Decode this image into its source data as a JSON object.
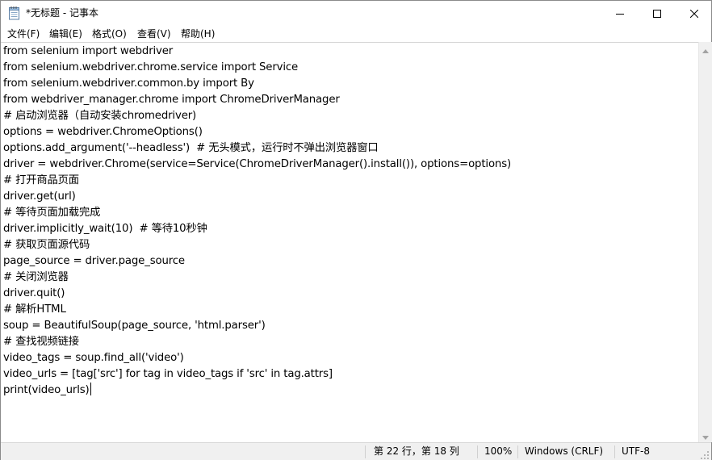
{
  "window": {
    "title": "*无标题 - 记事本",
    "icon": "notepad-icon",
    "controls": {
      "minimize": "minimize-icon",
      "maximize": "maximize-icon",
      "close": "close-icon"
    }
  },
  "menu": {
    "items": [
      {
        "label": "文件(F)"
      },
      {
        "label": "编辑(E)"
      },
      {
        "label": "格式(O)"
      },
      {
        "label": "查看(V)"
      },
      {
        "label": "帮助(H)"
      }
    ]
  },
  "editor": {
    "lines": [
      "from selenium import webdriver",
      "from selenium.webdriver.chrome.service import Service",
      "from selenium.webdriver.common.by import By",
      "from webdriver_manager.chrome import ChromeDriverManager",
      "# 启动浏览器（自动安装chromedriver)",
      "options = webdriver.ChromeOptions()",
      "options.add_argument('--headless')  # 无头模式，运行时不弹出浏览器窗口",
      "driver = webdriver.Chrome(service=Service(ChromeDriverManager().install()), options=options)",
      "# 打开商品页面",
      "driver.get(url)",
      "# 等待页面加载完成",
      "driver.implicitly_wait(10)  # 等待10秒钟",
      "# 获取页面源代码",
      "page_source = driver.page_source",
      "# 关闭浏览器",
      "driver.quit()",
      "# 解析HTML",
      "soup = BeautifulSoup(page_source, 'html.parser')",
      "# 查找视频链接",
      "video_tags = soup.find_all('video')",
      "video_urls = [tag['src'] for tag in video_tags if 'src' in tag.attrs]",
      "print(video_urls)"
    ]
  },
  "status": {
    "position": "第 22 行，第 18 列",
    "zoom": "100%",
    "line_ending": "Windows (CRLF)",
    "encoding": "UTF-8"
  }
}
